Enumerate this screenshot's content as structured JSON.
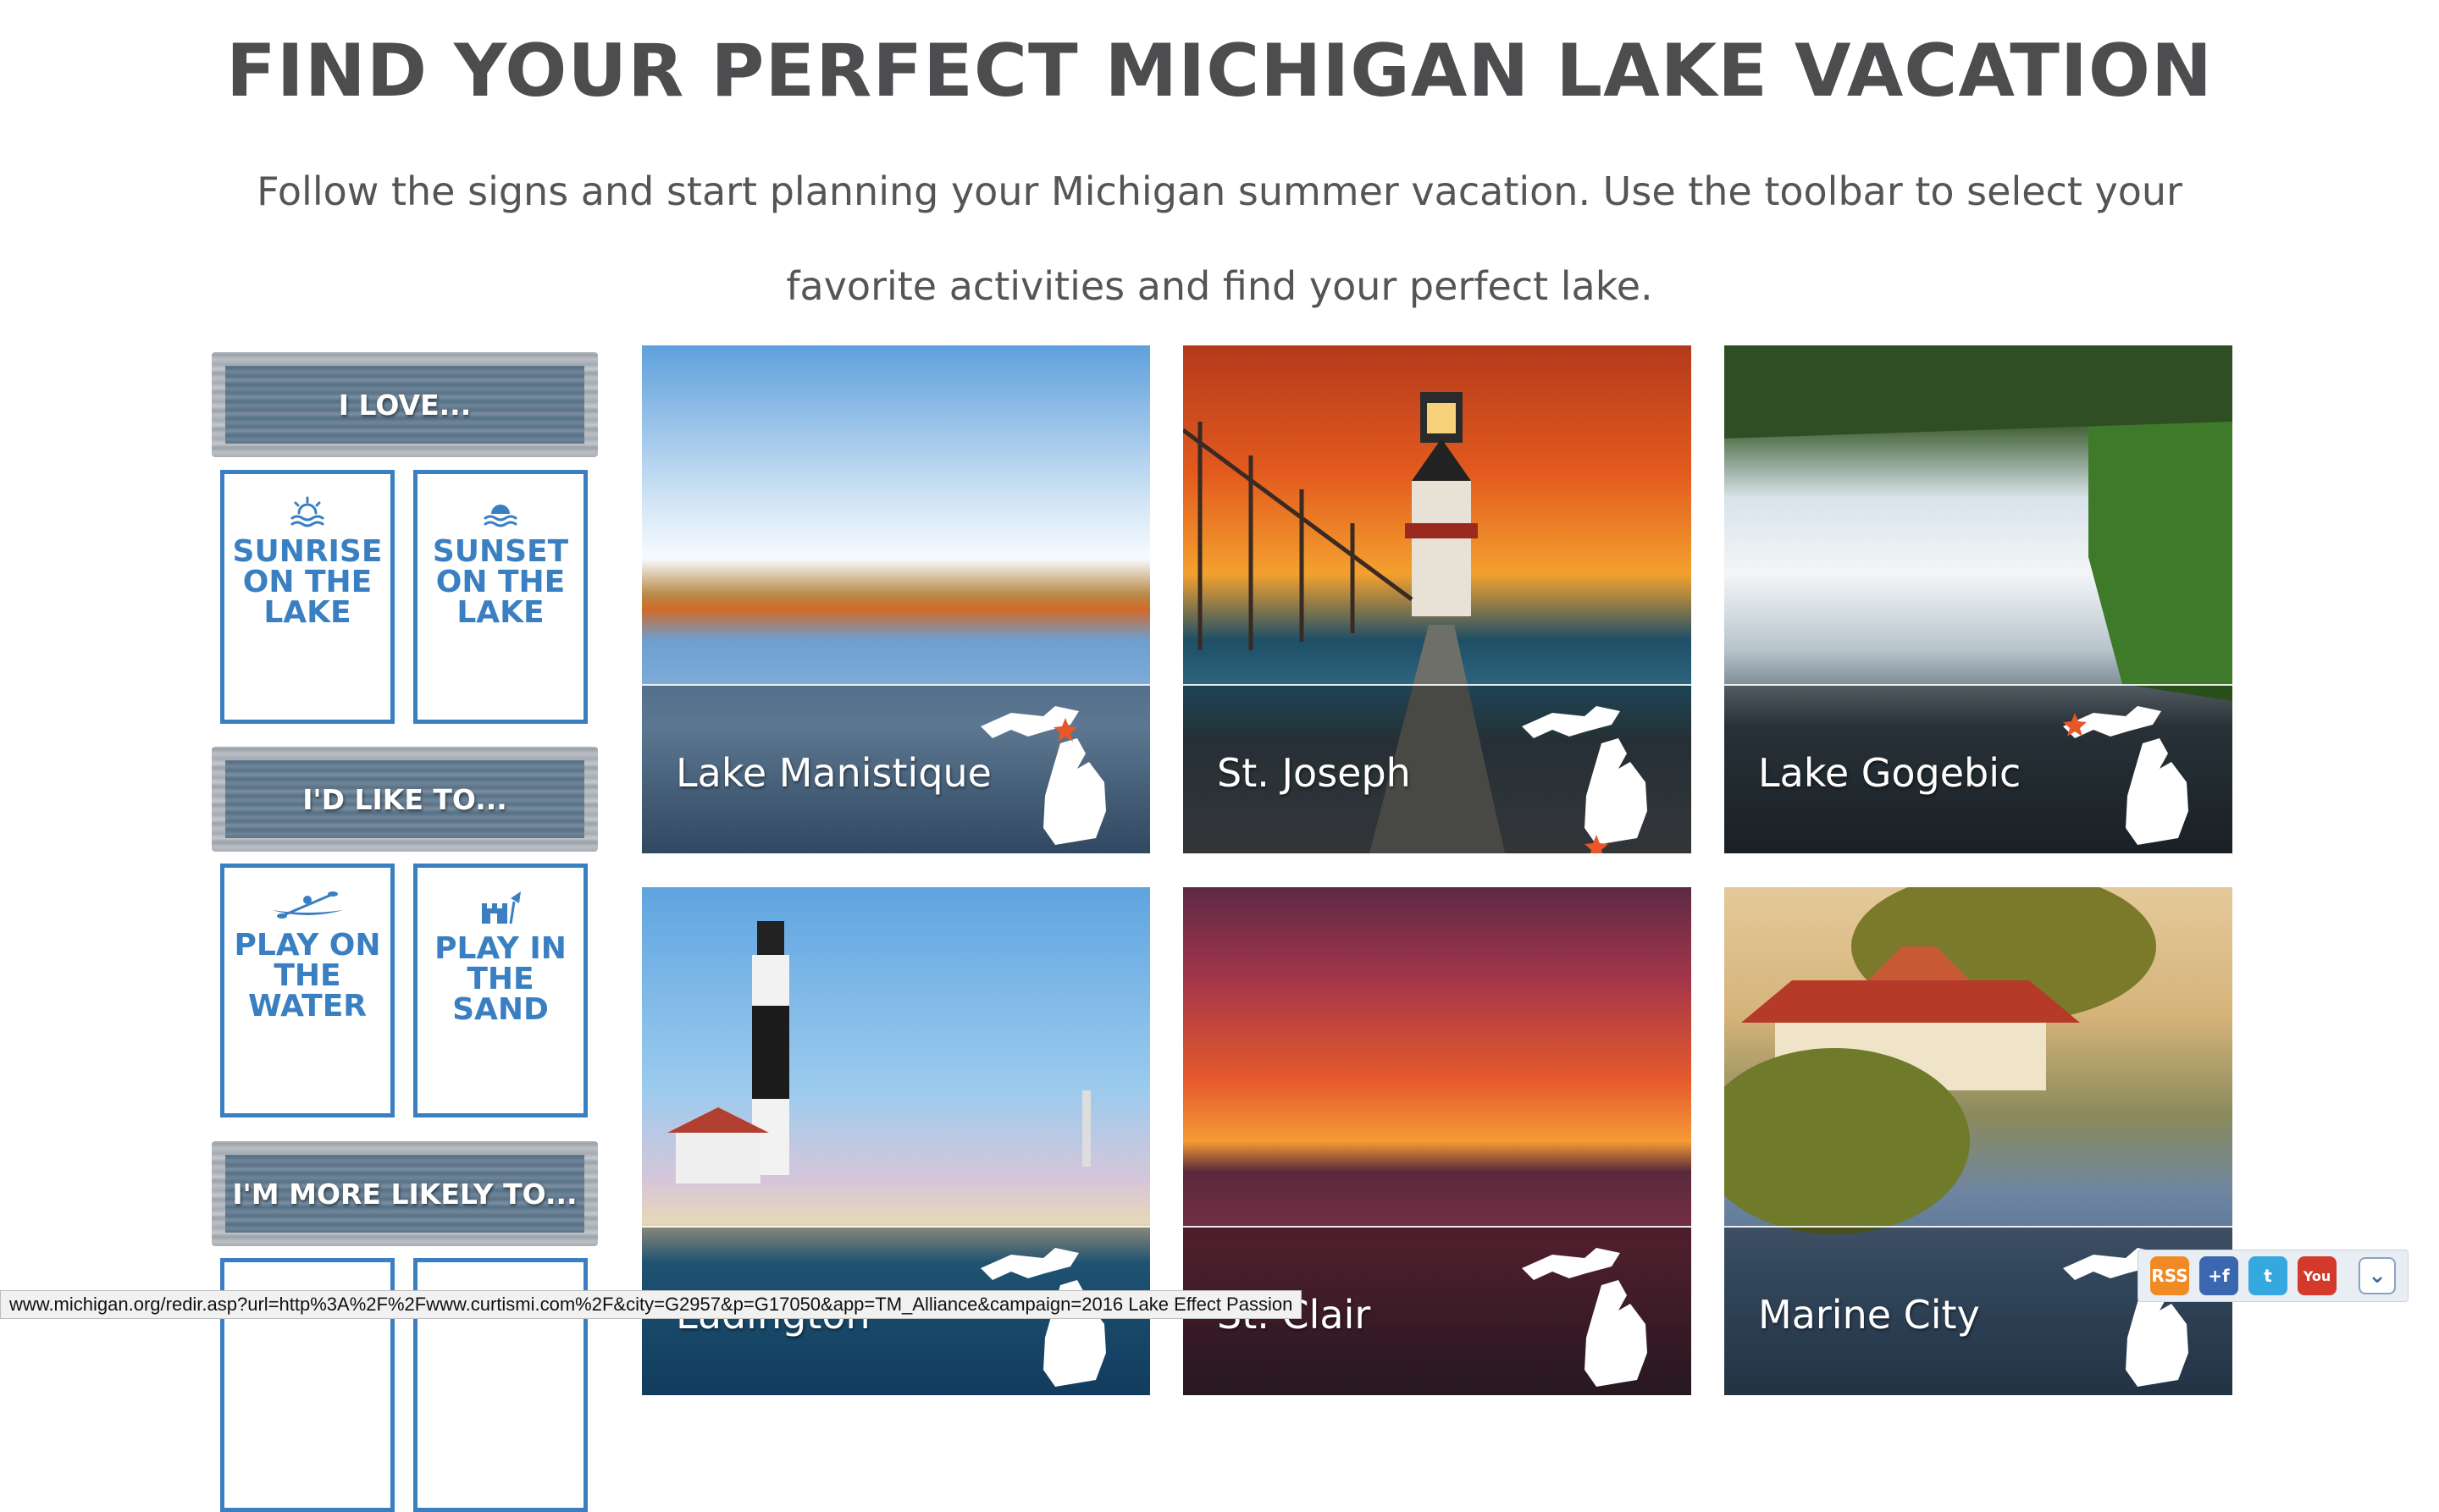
{
  "page": {
    "title": "FIND YOUR PERFECT MICHIGAN LAKE VACATION",
    "subtitle": "Follow the signs and start planning your Michigan summer vacation. Use the toolbar to select your favorite activities and find your perfect lake."
  },
  "sidebar": {
    "signs": [
      "I LOVE...",
      "I'D LIKE TO...",
      "I'M MORE LIKELY TO..."
    ],
    "tiles": [
      {
        "label": "SUNRISE ON THE LAKE",
        "icon": "sunrise-icon"
      },
      {
        "label": "SUNSET ON THE LAKE",
        "icon": "sunset-icon"
      },
      {
        "label": "PLAY ON THE WATER",
        "icon": "kayak-icon"
      },
      {
        "label": "PLAY IN THE SAND",
        "icon": "sandcastle-icon"
      }
    ]
  },
  "lakes": [
    {
      "name": "Lake Manistique",
      "icon": "michigan-map-icon"
    },
    {
      "name": "St. Joseph",
      "icon": "michigan-map-icon"
    },
    {
      "name": "Lake Gogebic",
      "icon": "michigan-map-icon"
    },
    {
      "name": "Ludington",
      "icon": "michigan-map-icon"
    },
    {
      "name": "St. Clair",
      "icon": "michigan-map-icon"
    },
    {
      "name": "Marine City",
      "icon": "michigan-map-icon"
    }
  ],
  "status_bar": {
    "url": "www.michigan.org/redir.asp?url=http%3A%2F%2Fwww.curtismi.com%2F&city=G2957&p=G17050&app=TM_Alliance&campaign=2016 Lake Effect Passion"
  },
  "social": {
    "icons": [
      "rss-icon",
      "google-plus-icon",
      "twitter-icon",
      "youtube-icon",
      "collapse-icon"
    ],
    "labels": [
      "RSS",
      "+f",
      "t",
      "You",
      "⌄"
    ],
    "colors": {
      "rss": "#f08a24",
      "plus": "#3b66b0",
      "twitter": "#35a8e0",
      "youtube": "#d33a2c"
    }
  },
  "colors": {
    "accent": "#3a7fc1",
    "title": "#4d4d4f",
    "star": "#e8572a"
  }
}
